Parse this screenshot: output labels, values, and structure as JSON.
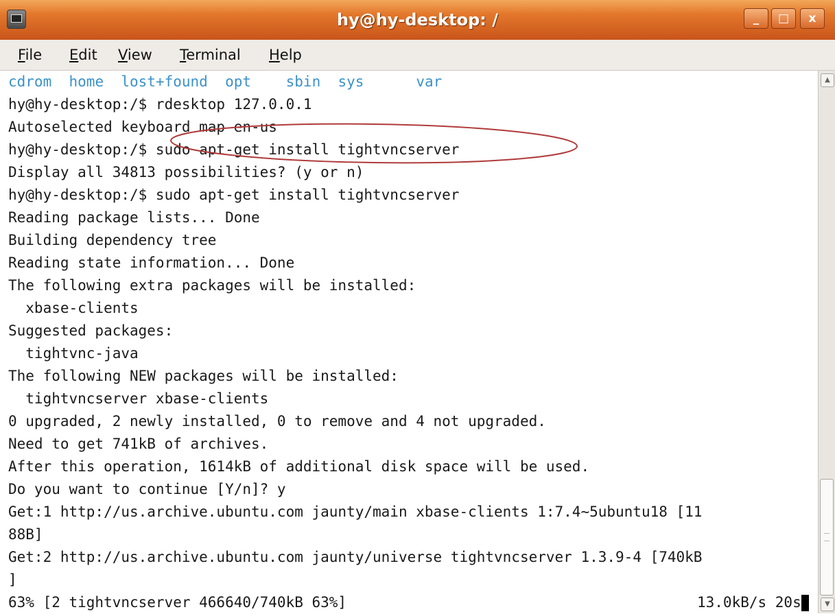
{
  "window": {
    "title": "hy@hy-desktop: /",
    "buttons": {
      "minimize": "_",
      "maximize": "□",
      "close": "x"
    }
  },
  "menu": [
    "File",
    "Edit",
    "View",
    "Terminal",
    "Help"
  ],
  "menu_mnemonic": [
    "F",
    "E",
    "V",
    "T",
    "H"
  ],
  "terminal": {
    "dir_listing": [
      "cdrom",
      "home",
      "lost+found",
      "opt",
      "sbin",
      "sys",
      "var"
    ],
    "lines": [
      "hy@hy-desktop:/$ rdesktop 127.0.0.1",
      "Autoselected keyboard map en-us",
      "hy@hy-desktop:/$ sudo apt-get install tightvncserver",
      "Display all 34813 possibilities? (y or n)",
      "hy@hy-desktop:/$ sudo apt-get install tightvncserver",
      "Reading package lists... Done",
      "Building dependency tree",
      "Reading state information... Done",
      "The following extra packages will be installed:",
      "  xbase-clients",
      "Suggested packages:",
      "  tightvnc-java",
      "The following NEW packages will be installed:",
      "  tightvncserver xbase-clients",
      "0 upgraded, 2 newly installed, 0 to remove and 4 not upgraded.",
      "Need to get 741kB of archives.",
      "After this operation, 1614kB of additional disk space will be used.",
      "Do you want to continue [Y/n]? y",
      "Get:1 http://us.archive.ubuntu.com jaunty/main xbase-clients 1:7.4~5ubuntu18 [11",
      "88B]",
      "Get:2 http://us.archive.ubuntu.com jaunty/universe tightvncserver 1.3.9-4 [740kB",
      "]"
    ],
    "progress_line": "63% [2 tightvncserver 466640/740kB 63%]",
    "speed": "13.0kB/s 20s"
  },
  "colors": {
    "titlebar": "#e3782c",
    "dir_blue": "#3b92c9",
    "annotation": "#b03a3a"
  }
}
